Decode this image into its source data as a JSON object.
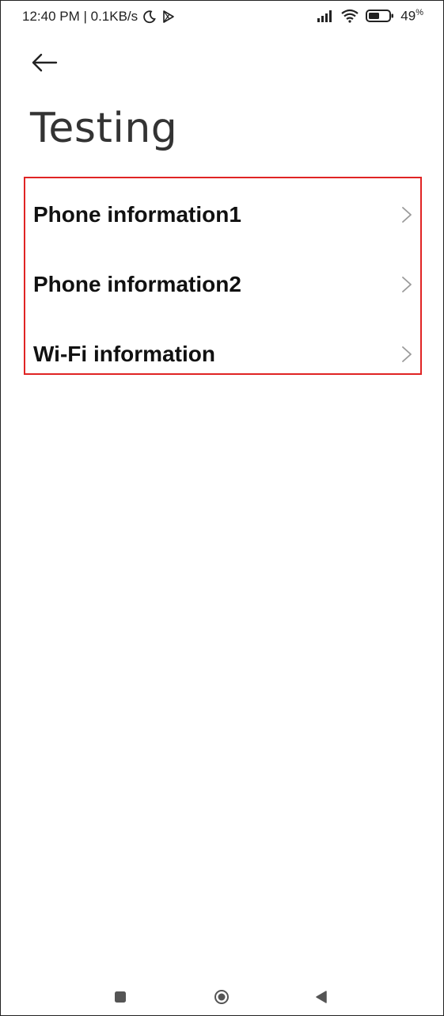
{
  "status_bar": {
    "time_speed": "12:40 PM | 0.1KB/s",
    "battery_percent": "49",
    "battery_unit": "%",
    "icons": [
      "moon-icon",
      "play-store-icon",
      "signal-icon",
      "wifi-icon",
      "battery-icon"
    ]
  },
  "header": {
    "back_icon": "back-arrow-icon",
    "title": "Testing"
  },
  "list": {
    "items": [
      {
        "label": "Phone information1"
      },
      {
        "label": "Phone information2"
      },
      {
        "label": "Wi-Fi information"
      }
    ]
  },
  "nav_bar": {
    "icons": [
      "recents-square-icon",
      "home-circle-icon",
      "back-triangle-icon"
    ]
  },
  "colors": {
    "highlight_border": "#e02424",
    "text_primary": "#111111",
    "chevron": "#9a9a9a"
  }
}
